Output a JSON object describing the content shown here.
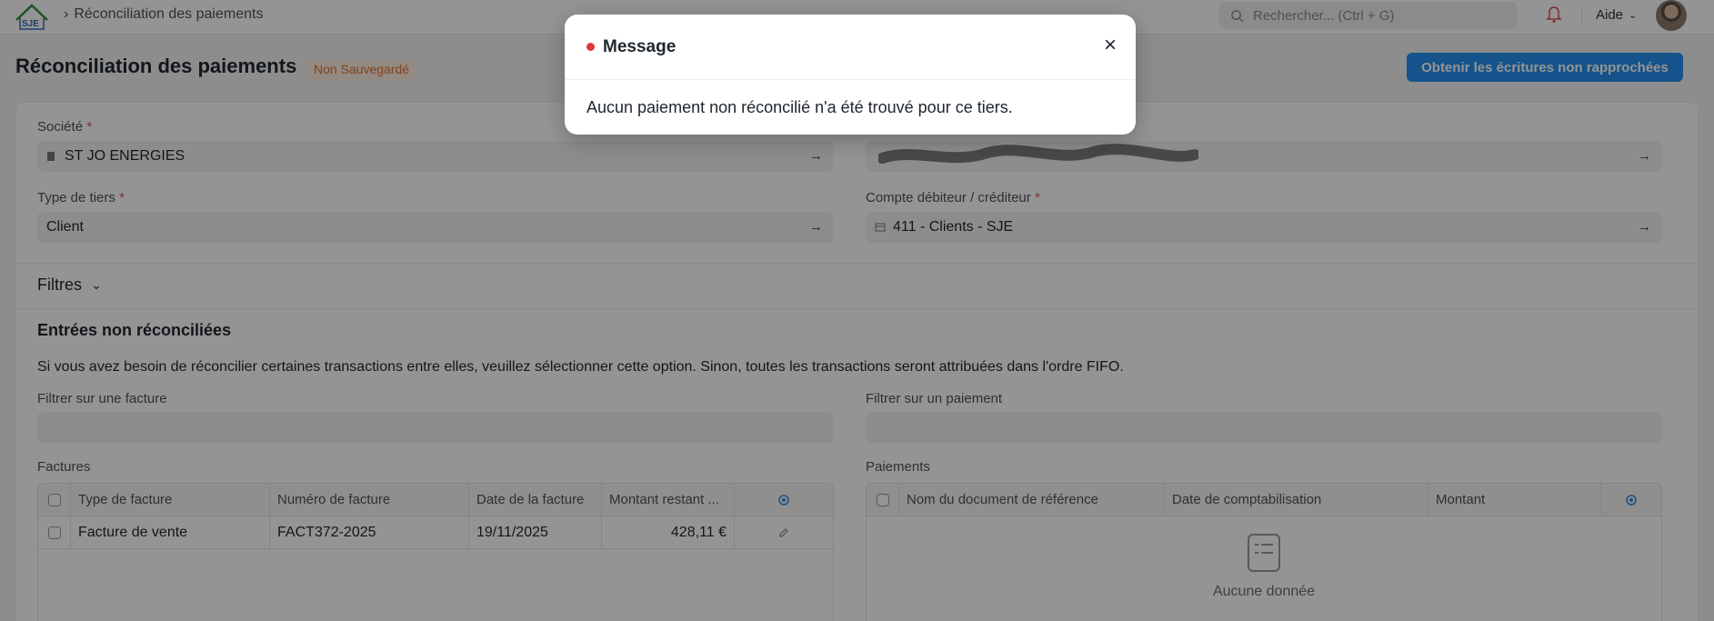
{
  "navbar": {
    "logo_text": "SJE",
    "breadcrumb": "Réconciliation des paiements",
    "search_placeholder": "Rechercher... (Ctrl + G)",
    "help_label": "Aide"
  },
  "header": {
    "title": "Réconciliation des paiements",
    "status_badge": "Non Sauvegardé",
    "primary_action": "Obtenir les écritures non rapprochées"
  },
  "form": {
    "company_label": "Société",
    "company_value": "ST JO ENERGIES",
    "party_type_label": "Type de tiers",
    "party_type_value": "Client",
    "account_label": "Compte débiteur / créditeur",
    "account_value": "411 - Clients - SJE",
    "required_mark": "*"
  },
  "filters": {
    "label": "Filtres"
  },
  "unreconciled": {
    "title": "Entrées non réconciliées",
    "description": "Si vous avez besoin de réconcilier certaines transactions entre elles, veuillez sélectionner cette option. Sinon, toutes les transactions seront attribuées dans l'ordre FIFO.",
    "filter_invoice_label": "Filtrer sur une facture",
    "filter_payment_label": "Filtrer sur un paiement"
  },
  "invoices": {
    "label": "Factures",
    "columns": [
      "Type de facture",
      "Numéro de facture",
      "Date de la facture",
      "Montant restant ..."
    ],
    "rows": [
      {
        "type": "Facture de vente",
        "number": "FACT372-2025",
        "date": "19/11/2025",
        "amount": "428,11 €"
      }
    ]
  },
  "payments": {
    "label": "Paiements",
    "columns": [
      "Nom du document de référence",
      "Date de comptabilisation",
      "Montant"
    ],
    "empty_text": "Aucune donnée"
  },
  "modal": {
    "title": "Message",
    "body": "Aucun paiement non réconcilié n'a été trouvé pour ce tiers.",
    "indicator_color": "#e03636"
  },
  "colors": {
    "accent": "#2490ef",
    "warning": "#e0732c"
  }
}
